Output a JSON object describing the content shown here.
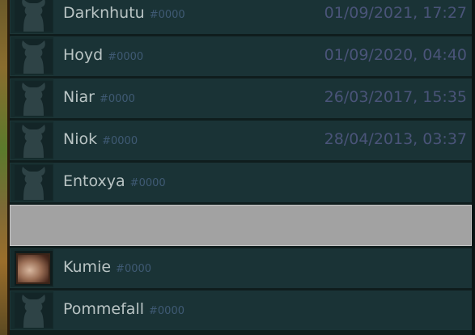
{
  "contacts": [
    {
      "name": "Darknhutu",
      "tag": "#0000",
      "date": "01/09/2021, 17:27",
      "avatar": "silhouette-icon"
    },
    {
      "name": "Hoyd",
      "tag": "#0000",
      "date": "01/09/2020, 04:40",
      "avatar": "silhouette-icon"
    },
    {
      "name": "Niar",
      "tag": "#0000",
      "date": "26/03/2017, 15:35",
      "avatar": "silhouette-icon"
    },
    {
      "name": "Niok",
      "tag": "#0000",
      "date": "28/04/2013, 03:37",
      "avatar": "silhouette-icon"
    },
    {
      "name": "Entoxya",
      "tag": "#0000",
      "date": "",
      "avatar": "silhouette-icon"
    },
    {
      "name": "Kumie",
      "tag": "#0000",
      "date": "",
      "avatar": "photo-avatar"
    },
    {
      "name": "Pommefall",
      "tag": "#0000",
      "date": "",
      "avatar": "silhouette-icon"
    }
  ],
  "colors": {
    "row_bg": "#1a3336",
    "name_text": "#b9c4c4",
    "tag_text": "#3f5a74",
    "date_text": "#4a5479",
    "blank_row": "#a2a2a2"
  }
}
